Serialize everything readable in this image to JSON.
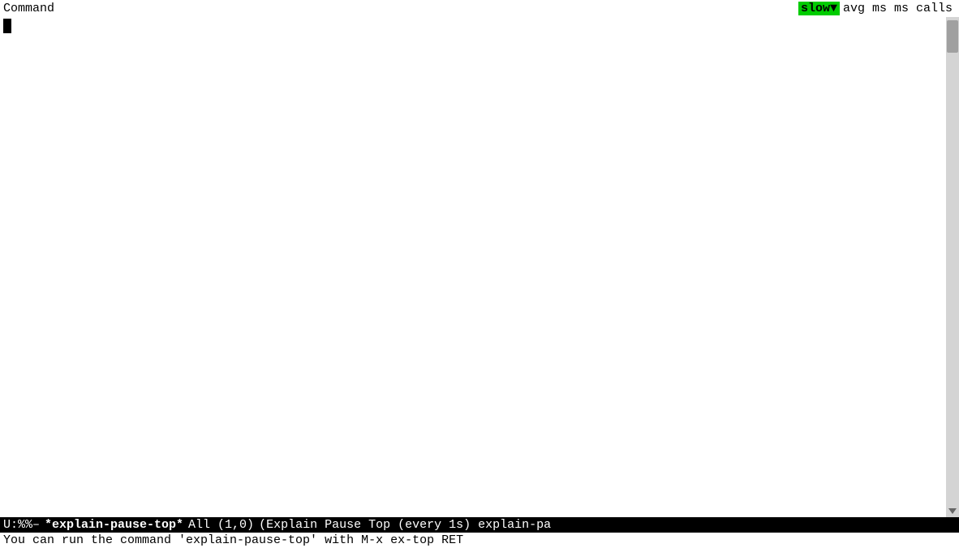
{
  "header": {
    "left_label": "Command",
    "slow_label": "slow",
    "slow_arrow": "▼",
    "right_labels": "avg ms ms calls"
  },
  "editor": {
    "cursor_visible": true
  },
  "mode_line": {
    "prefix": "U:%%–",
    "buffer_name": "*explain-pause-top*",
    "position": "All (1,0)",
    "mode": "(Explain Pause Top (every 1s) explain-pa"
  },
  "echo_area": {
    "text": "You can run the command 'explain-pause-top' with M-x ex-top RET"
  },
  "colors": {
    "background": "#ffffff",
    "foreground": "#000000",
    "slow_bg": "#00cc00",
    "mode_line_bg": "#000000",
    "mode_line_fg": "#ffffff",
    "scrollbar_bg": "#d4d4d4",
    "scrollbar_thumb": "#a0a0a0"
  }
}
